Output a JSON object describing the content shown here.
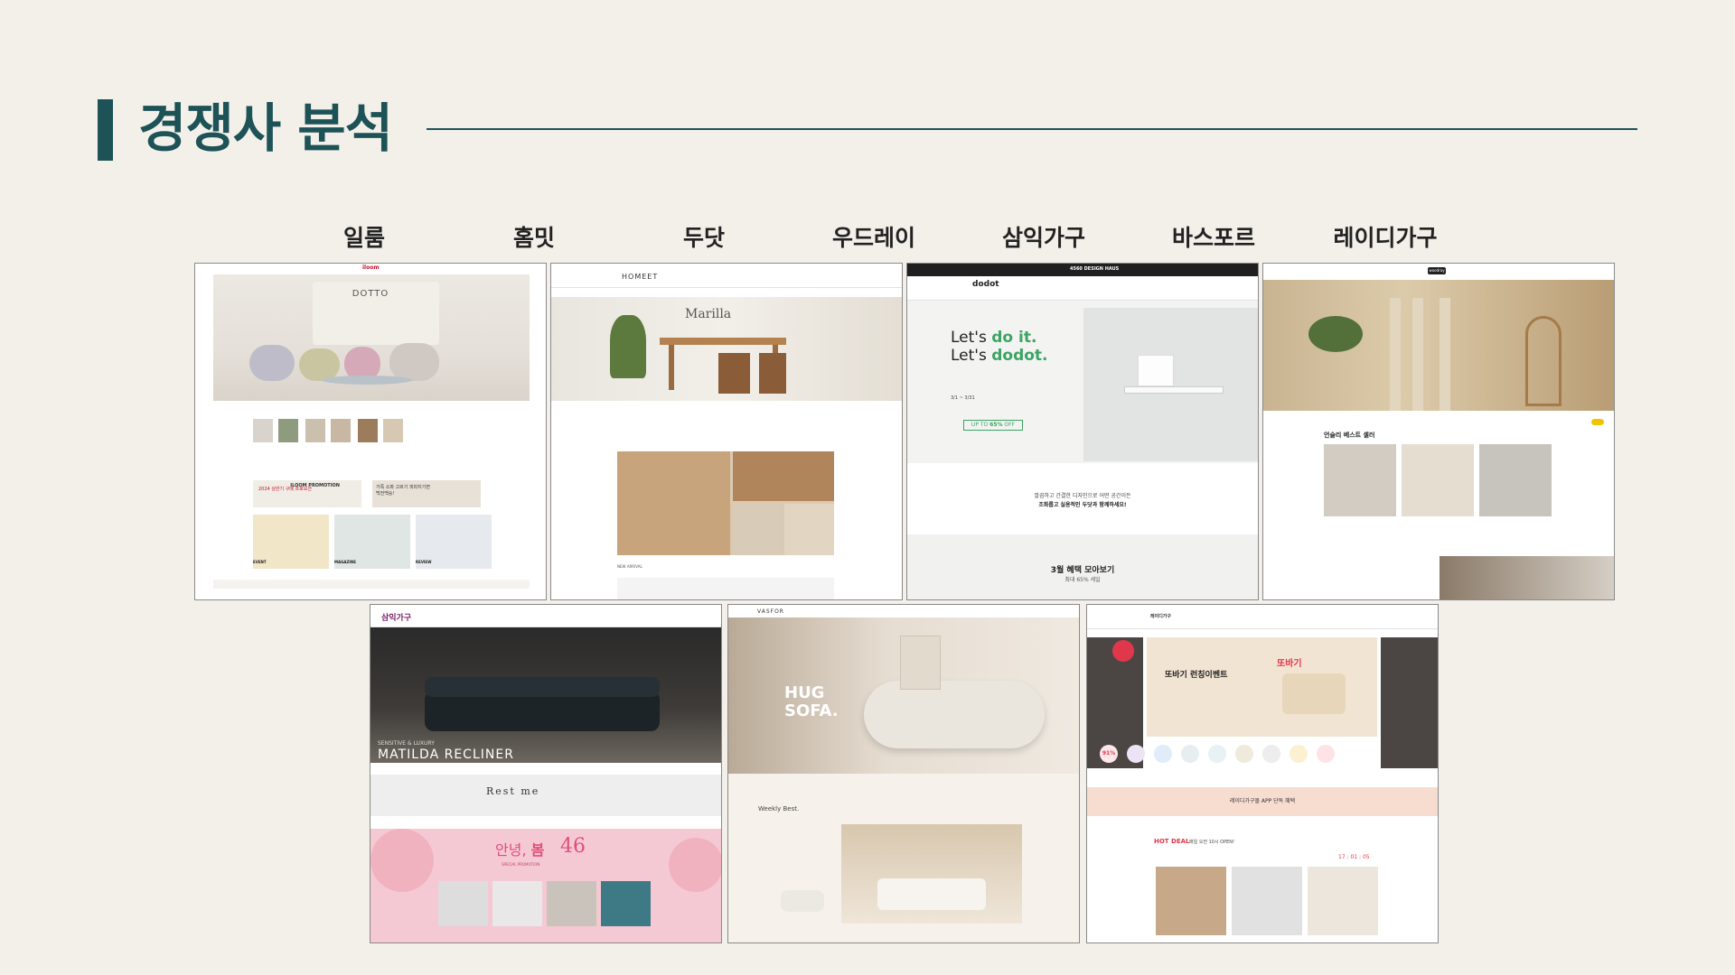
{
  "slide": {
    "title": "경쟁사 분석"
  },
  "brands": [
    "일룸",
    "홈밋",
    "두닷",
    "우드레이",
    "삼익가구",
    "바스포르",
    "레이디가구"
  ],
  "shots": {
    "iloom": {
      "logo": "iloom",
      "hero_title": "DOTTO",
      "promo_1": "2024 상반기 구매 프로모션",
      "promo_2": "ILOOM PROMOTION",
      "promo_3": "가족 소파 고르기 피피지기면 백전백승!",
      "event_tag": "EVENT",
      "magazine_tag": "MAGAZINE",
      "review_tag": "REVIEW"
    },
    "homeet": {
      "logo": "HOMEET",
      "hero_title": "Marilla",
      "new_arrival": "NEW ARRIVAL"
    },
    "dodot": {
      "top_banner": "4560 DESIGN HAUS",
      "logo": "dodot",
      "headline_1a": "Let's ",
      "headline_1b": "do it.",
      "headline_2a": "Let's ",
      "headline_2b": "dodot.",
      "date": "3/1 ~ 3/31",
      "discount_a": "UP TO ",
      "discount_b": "65%",
      "discount_c": " OFF",
      "copy_1": "깔끔하고 간결한 디자인으로 어떤 공간이든",
      "copy_2": "조화롭고 실용적인 두닷과 함께하세요!",
      "benefit_title": "3월 혜택 모아보기",
      "benefit_sub": "최대 65% 세일"
    },
    "woodray": {
      "logo": "woodray",
      "section_title": "언슬리 베스트 셀러"
    },
    "samick": {
      "logo": "삼익가구",
      "hero_sub": "SENSITIVE & LUXURY",
      "hero_title": "MATILDA RECLINER",
      "restme": "Rest me",
      "spring_a": "안녕, ",
      "spring_b": "봄",
      "spring_num": "46",
      "spring_label": "SPECIAL PROMOTION"
    },
    "vasfor": {
      "logo": "VASFOR",
      "hero_title_1": "HUG",
      "hero_title_2": "SOFA.",
      "weekly": "Weekly Best."
    },
    "lady": {
      "logo": "레이디가구",
      "event_title": "또바기 런칭이벤트",
      "event_art": "또바기",
      "badge": "91%",
      "app_banner": "레이디가구몰 APP 단독 혜택",
      "hotdeal": "HOT DEAL",
      "hotdeal_sub": "매일 오전 10시 OPEN!",
      "timer": "17 : 01 : 05"
    }
  },
  "colors": {
    "background": "#f3f0ea",
    "accent": "#1d5257",
    "dodot_green": "#3aa564",
    "lady_red": "#e0384a",
    "samick_pink": "#f5c9d3"
  }
}
